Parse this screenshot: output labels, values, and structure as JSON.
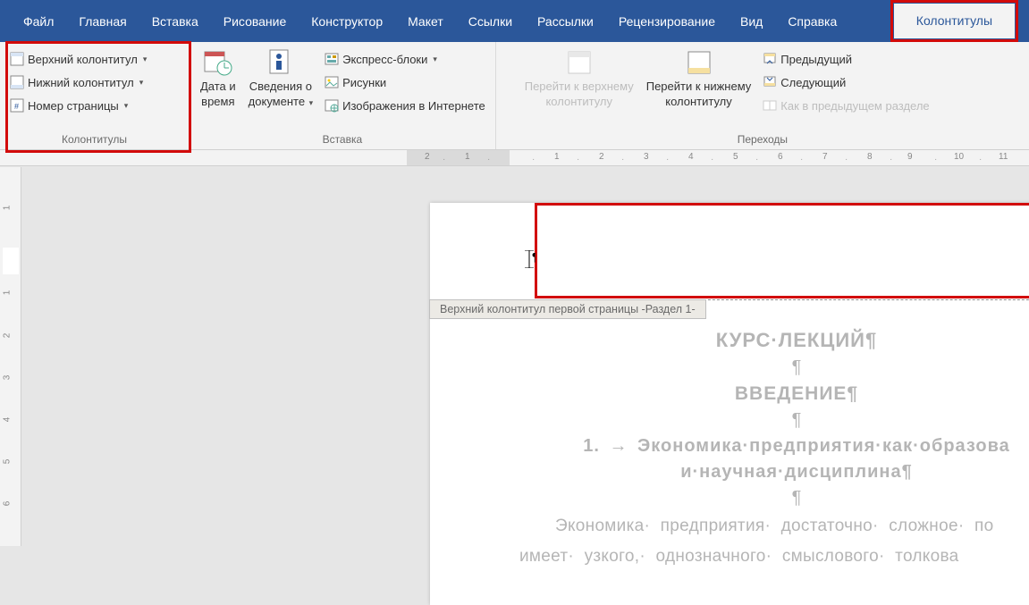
{
  "tabs": {
    "file": "Файл",
    "home": "Главная",
    "insert": "Вставка",
    "draw": "Рисование",
    "design": "Конструктор",
    "layout": "Макет",
    "references": "Ссылки",
    "mailings": "Рассылки",
    "review": "Рецензирование",
    "view": "Вид",
    "help": "Справка",
    "headerfooter": "Колонтитулы"
  },
  "ribbon": {
    "groups": {
      "hf": {
        "label": "Колонтитулы",
        "header": "Верхний колонтитул",
        "footer": "Нижний колонтитул",
        "pagenum": "Номер страницы"
      },
      "insert": {
        "label": "Вставка",
        "datetime1": "Дата и",
        "datetime2": "время",
        "docinfo1": "Сведения о",
        "docinfo2": "документе",
        "quickparts": "Экспресс-блоки",
        "pictures": "Рисунки",
        "onlinepics": "Изображения в Интернете"
      },
      "nav": {
        "label": "Переходы",
        "gotoheader1": "Перейти к верхнему",
        "gotoheader2": "колонтитулу",
        "gotofooter1": "Перейти к нижнему",
        "gotofooter2": "колонтитулу",
        "previous": "Предыдущий",
        "next": "Следующий",
        "linkprev": "Как в предыдущем разделе"
      }
    }
  },
  "ruler_h": [
    "2",
    "1",
    "1",
    "2",
    "3",
    "4",
    "5",
    "6",
    "7",
    "8",
    "9",
    "10",
    "11"
  ],
  "ruler_v": [
    "1",
    "1",
    "2",
    "3",
    "4",
    "5",
    "6"
  ],
  "doc": {
    "header_tab": "Верхний колонтитул первой страницы -Раздел 1-",
    "title1": "КУРС·ЛЕКЦИЙ¶",
    "pilcrow": "¶",
    "title2": "ВВЕДЕНИЕ¶",
    "num_title1": "1.  →  Экономика·предприятия·как·образова",
    "num_title2": "и·научная·дисциплина¶",
    "para1": "Экономика· предприятия· достаточно· сложное· по",
    "para2": "имеет· узкого,· однозначного· смыслового· толкова"
  }
}
